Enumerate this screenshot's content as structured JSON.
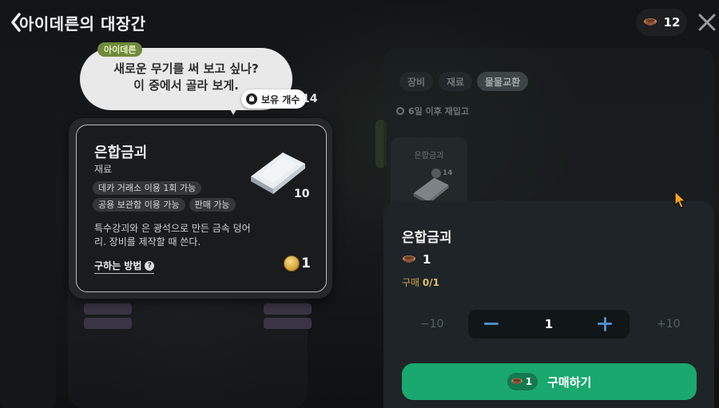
{
  "header": {
    "title": "아이데른의 대장간",
    "currency_amount": "12"
  },
  "npc": {
    "name": "아이데른",
    "speech_line1": "새로운 무기를 써 보고 싶나?",
    "speech_line2": "이 중에서 골라 보게."
  },
  "owned": {
    "label": "보유 개수",
    "count": "14"
  },
  "tooltip": {
    "item_name": "은합금괴",
    "item_type": "재료",
    "tags": [
      "데카 거래소 이용 1회 가능",
      "공용 보관함 이용 가능",
      "판매 가능"
    ],
    "description": "특수강괴와 은 광석으로 만든 금속 덩어리. 장비를 제작할 때 쓴다.",
    "howto_label": "구하는 방법",
    "quantity": "10",
    "price": "1"
  },
  "shop": {
    "tabs": [
      {
        "label": "장비",
        "active": false
      },
      {
        "label": "재료",
        "active": false
      },
      {
        "label": "물물교환",
        "active": true
      }
    ],
    "restock_text": "6일 이후 재입고",
    "item_name": "은합금괴",
    "item_badge": "14"
  },
  "purchase": {
    "title": "은합금괴",
    "price": "1",
    "limit_label": "구매",
    "limit_value": "0/1",
    "minus10": "−10",
    "plus10": "+10",
    "quantity": "1",
    "button_cost": "1",
    "button_label": "구매하기"
  },
  "colors": {
    "accent_green": "#1aa86e",
    "stepper_blue": "#4c8ec8",
    "limit_gold": "#c9a34a"
  },
  "icons": {
    "back": "chevron-left-icon",
    "close": "close-icon",
    "currency": "bowl-token-icon",
    "owned": "bag-icon",
    "coin": "gold-coin-icon",
    "clock": "clock-icon"
  }
}
